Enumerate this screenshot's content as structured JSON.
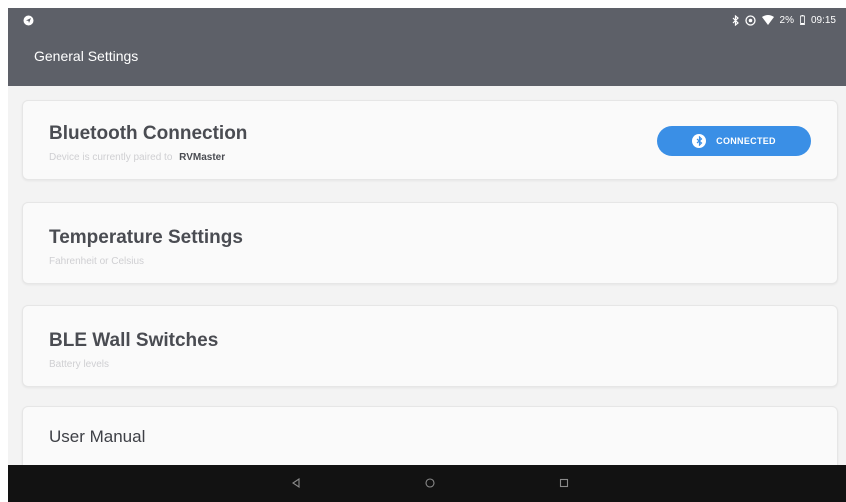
{
  "status_bar": {
    "left_icon": "location-icon",
    "battery_percent": "2%",
    "time": "09:15"
  },
  "app_bar": {
    "title": "General Settings"
  },
  "settings": [
    {
      "title": "Bluetooth Connection",
      "subtitle": "Device is currently paired to",
      "device_name": "RVMaster",
      "status_button": "CONNECTED"
    },
    {
      "title": "Temperature Settings",
      "subtitle": "Fahrenheit or Celsius"
    },
    {
      "title": "BLE Wall Switches",
      "subtitle": "Battery levels"
    },
    {
      "title": "User Manual"
    }
  ],
  "colors": {
    "app_bar": "#5d6068",
    "accent": "#3a8fe6",
    "nav_bar": "#121212",
    "background": "#f3f3f3"
  }
}
